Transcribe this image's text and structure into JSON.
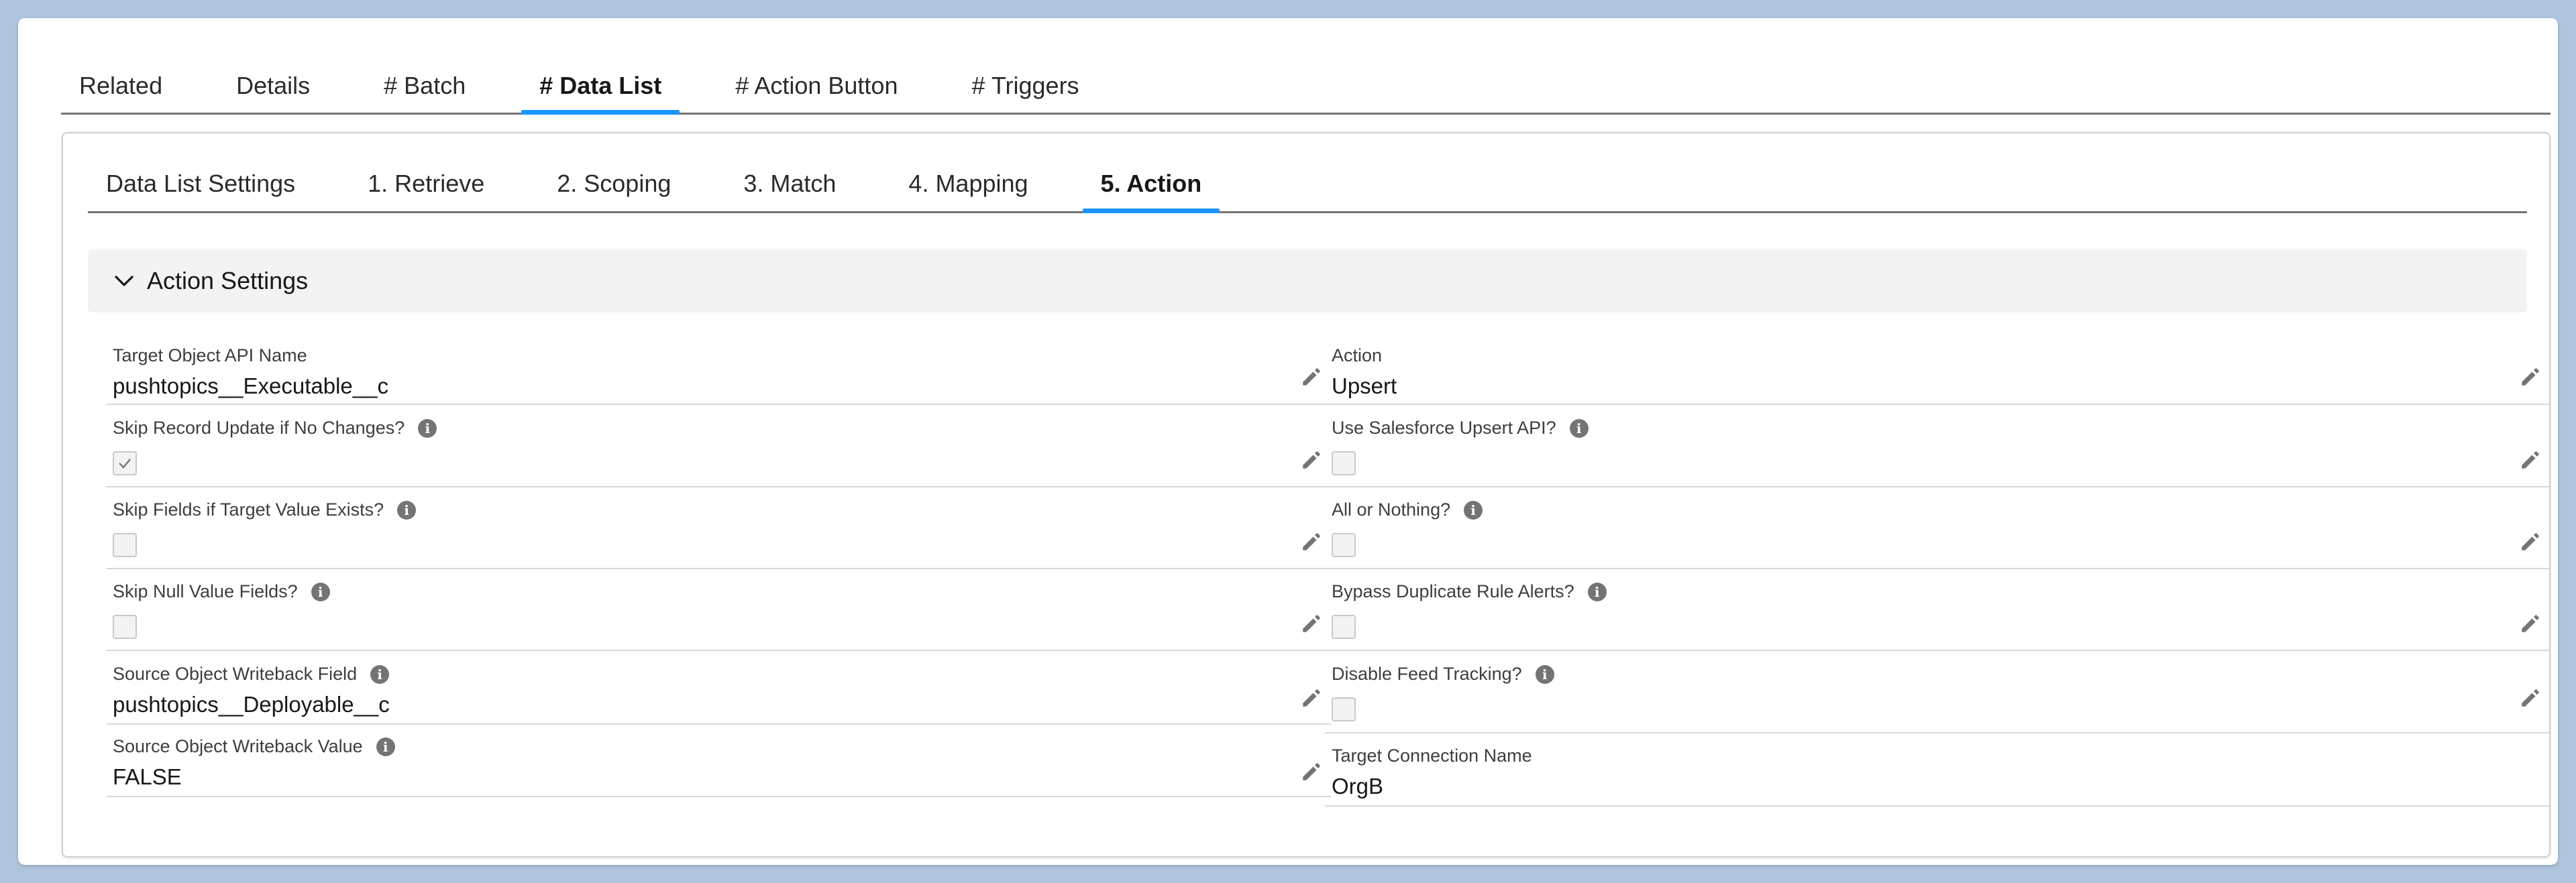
{
  "outer_tabs": [
    {
      "label": "Related"
    },
    {
      "label": "Details"
    },
    {
      "label": "# Batch"
    },
    {
      "label": "# Data List"
    },
    {
      "label": "# Action Button"
    },
    {
      "label": "# Triggers"
    }
  ],
  "outer_active_tab": "# Data List",
  "inner_tabs": [
    {
      "label": "Data List Settings"
    },
    {
      "label": "1. Retrieve"
    },
    {
      "label": "2. Scoping"
    },
    {
      "label": "3. Match"
    },
    {
      "label": "4. Mapping"
    },
    {
      "label": "5. Action"
    }
  ],
  "inner_active_tab": "5. Action",
  "section": {
    "title": "Action Settings",
    "icon": "chevron-down-icon"
  },
  "left_fields": {
    "target_object": {
      "label": "Target Object API Name",
      "value": "pushtopics__Executable__c"
    },
    "skip_record_update": {
      "label": "Skip Record Update if No Changes?",
      "checked": true
    },
    "skip_fields": {
      "label": "Skip Fields if Target Value Exists?",
      "checked": false
    },
    "skip_null": {
      "label": "Skip Null Value Fields?",
      "checked": false
    },
    "writeback_field": {
      "label": "Source Object Writeback Field",
      "value": "pushtopics__Deployable__c"
    },
    "writeback_value": {
      "label": "Source Object Writeback Value",
      "value": "FALSE"
    }
  },
  "right_fields": {
    "action": {
      "label": "Action",
      "value": "Upsert"
    },
    "use_upsert_api": {
      "label": "Use Salesforce Upsert API?",
      "checked": false
    },
    "all_or_nothing": {
      "label": "All or Nothing?",
      "checked": false
    },
    "bypass_duplicate": {
      "label": "Bypass Duplicate Rule Alerts?",
      "checked": false
    },
    "disable_feed": {
      "label": "Disable Feed Tracking?",
      "checked": false
    },
    "target_connection": {
      "label": "Target Connection Name",
      "value": "OrgB"
    }
  },
  "icons": {
    "edit": "pencil-icon",
    "info": "info-icon",
    "check": "checkmark-icon"
  },
  "info_glyph": "i",
  "colors": {
    "accent": "#1b96ff",
    "background": "#b0c4de",
    "section_bg": "#f3f3f3"
  }
}
